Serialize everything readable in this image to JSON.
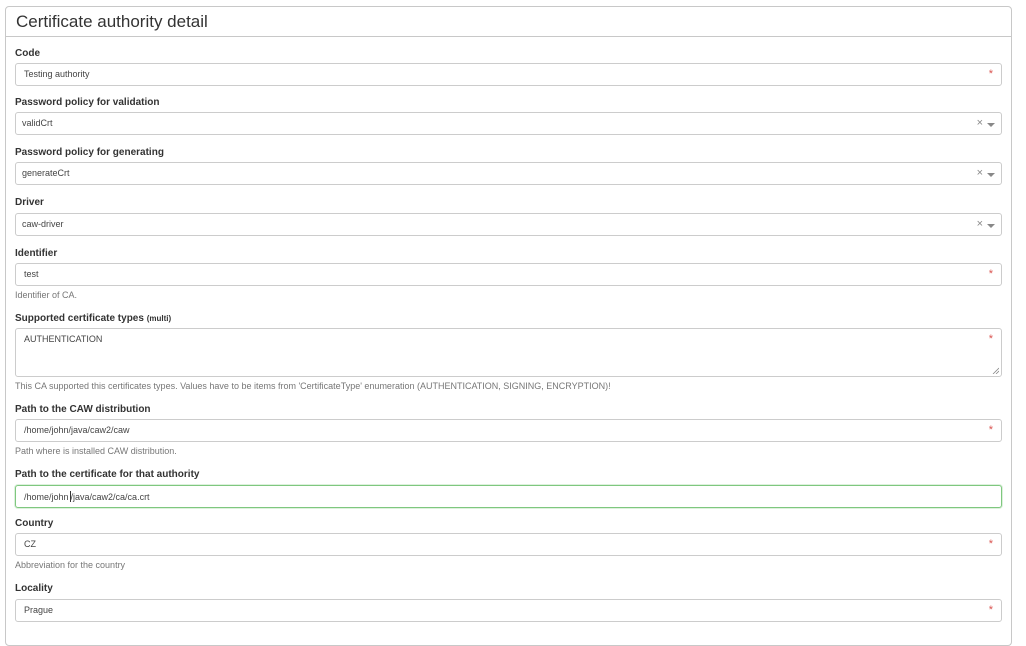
{
  "panel": {
    "title": "Certificate authority detail"
  },
  "fields": {
    "code": {
      "label": "Code",
      "value": "Testing authority",
      "required": "*"
    },
    "password_validation": {
      "label": "Password policy for validation",
      "value": "validCrt",
      "clear": "×"
    },
    "password_generating": {
      "label": "Password policy for generating",
      "value": "generateCrt",
      "clear": "×"
    },
    "driver": {
      "label": "Driver",
      "value": "caw-driver",
      "clear": "×"
    },
    "identifier": {
      "label": "Identifier",
      "value": "test",
      "required": "*",
      "help": "Identifier of CA."
    },
    "cert_types": {
      "label": "Supported certificate types",
      "label_suffix": "(multi)",
      "value": "AUTHENTICATION",
      "required": "*",
      "help": "This CA supported this certificates types. Values have to be items from 'CertificateType' enumeration (AUTHENTICATION, SIGNING, ENCRYPTION)!"
    },
    "caw_path": {
      "label": "Path to the CAW distribution",
      "value": "/home/john/java/caw2/caw",
      "required": "*",
      "help": "Path where is installed CAW distribution."
    },
    "cert_path": {
      "label": "Path to the certificate for that authority",
      "value_before_cursor": "/home/john",
      "value_after_cursor": "/java/caw2/ca/ca.crt"
    },
    "country": {
      "label": "Country",
      "value": "CZ",
      "required": "*",
      "help": "Abbreviation for the country"
    },
    "locality": {
      "label": "Locality",
      "value": "Prague",
      "required": "*"
    }
  },
  "colors": {
    "required": "#d9534f",
    "focus_border": "#7fc77f",
    "border": "#cccccc"
  }
}
